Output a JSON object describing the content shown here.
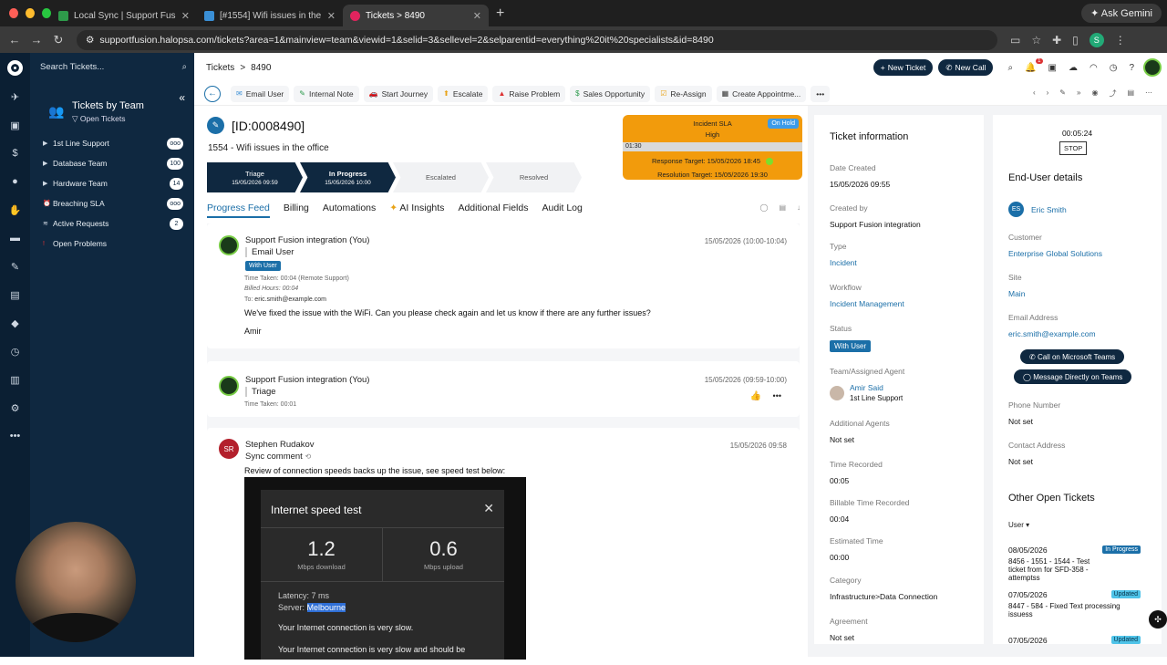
{
  "browser": {
    "tabs": [
      {
        "title": "Local Sync | Support Fusion",
        "fav": "#2e9a4a"
      },
      {
        "title": "[#1554] Wifi issues in the offi",
        "fav": "#3a8fd6"
      },
      {
        "title": "Tickets > 8490",
        "fav": "#e0245e"
      }
    ],
    "gemini": "Ask Gemini",
    "url": "supportfusion.halopsa.com/tickets?area=1&mainview=team&viewid=1&selid=3&sellevel=2&selparentid=everything%20it%20specialists&id=8490",
    "profile": "S"
  },
  "sidebar": {
    "search_placeholder": "Search Tickets...",
    "title": "Tickets by Team",
    "subtitle": "Open Tickets",
    "items": [
      {
        "label": "1st Line Support",
        "count": "ooo"
      },
      {
        "label": "Database Team",
        "count": "100"
      },
      {
        "label": "Hardware Team",
        "count": "14"
      },
      {
        "label": "Breaching SLA",
        "count": "ooo"
      },
      {
        "label": "Active Requests",
        "count": "2"
      },
      {
        "label": "Open Problems",
        "count": ""
      }
    ]
  },
  "topbar": {
    "crumb_root": "Tickets",
    "crumb_sep": ">",
    "crumb_id": "8490",
    "new_ticket": "New Ticket",
    "new_call": "New Call",
    "notif_count": "1"
  },
  "actions": [
    {
      "label": "Email User",
      "icon": "✉"
    },
    {
      "label": "Internal Note",
      "icon": "✎"
    },
    {
      "label": "Start Journey",
      "icon": "🚗"
    },
    {
      "label": "Escalate",
      "icon": "⬆"
    },
    {
      "label": "Raise Problem",
      "icon": "▲"
    },
    {
      "label": "Sales Opportunity",
      "icon": "$"
    },
    {
      "label": "Re-Assign",
      "icon": "☑"
    },
    {
      "label": "Create Appointme...",
      "icon": "▦"
    }
  ],
  "ticket": {
    "id": "[ID:0008490]",
    "summary": "1554 - Wifi issues in the office",
    "stages": [
      {
        "name": "Triage",
        "date": "15/05/2026 09:59"
      },
      {
        "name": "In Progress",
        "date": "15/05/2026 10:00"
      },
      {
        "name": "Escalated",
        "date": ""
      },
      {
        "name": "Resolved",
        "date": ""
      }
    ],
    "sla": {
      "title": "Incident SLA",
      "priority": "High",
      "status": "On Hold",
      "elapsed": "01:30",
      "response": "Response Target: 15/05/2026 18:45",
      "resolution": "Resolution Target: 15/05/2026 19:30"
    }
  },
  "tabs": [
    "Progress Feed",
    "Billing",
    "Automations",
    "AI Insights",
    "Additional Fields",
    "Audit Log"
  ],
  "feed": [
    {
      "author": "Support Fusion integration (You)",
      "action": "Email User",
      "status": "With User",
      "time_taken": "Time Taken: 00:04 (Remote Support)",
      "billed": "Billed Hours: 00:04",
      "to_label": "To:",
      "to": "eric.smith@example.com",
      "body": "We've fixed the issue with the WiFi. Can you please check again and let us know if there are any further issues?",
      "sign": "Amir",
      "time": "15/05/2026 (10:00-10:04)"
    },
    {
      "author": "Support Fusion integration (You)",
      "action": "Triage",
      "time_taken": "Time Taken: 00:01",
      "time": "15/05/2026 (09:59-10:00)"
    },
    {
      "author": "Stephen Rudakov",
      "initials": "SR",
      "action": "Sync comment",
      "body": "Review of connection speeds backs up the issue, see speed test below:",
      "time": "15/05/2026 09:58",
      "speedtest": {
        "title": "Internet speed test",
        "down": "1.2",
        "down_unit": "Mbps download",
        "up": "0.6",
        "up_unit": "Mbps upload",
        "latency": "Latency: 7 ms",
        "server_label": "Server:",
        "server": "Melbourne",
        "msg1": "Your Internet connection is very slow.",
        "msg2": "Your Internet connection is very slow and should be"
      }
    }
  ],
  "info": {
    "title": "Ticket information",
    "date_created_l": "Date Created",
    "date_created": "15/05/2026 09:55",
    "created_by_l": "Created by",
    "created_by": "Support Fusion integration",
    "type_l": "Type",
    "type": "Incident",
    "workflow_l": "Workflow",
    "workflow": "Incident Management",
    "status_l": "Status",
    "status": "With User",
    "agent_l": "Team/Assigned Agent",
    "agent": "Amir Said",
    "team": "1st Line Support",
    "add_agents_l": "Additional Agents",
    "add_agents": "Not set",
    "time_rec_l": "Time Recorded",
    "time_rec": "00:05",
    "bill_time_l": "Billable Time Recorded",
    "bill_time": "00:04",
    "est_l": "Estimated Time",
    "est": "00:00",
    "cat_l": "Category",
    "cat": "Infrastructure>Data Connection",
    "agreement_l": "Agreement",
    "agreement": "Not set"
  },
  "enduser": {
    "timer": "00:05:24",
    "stop": "STOP",
    "title": "End-User details",
    "initials": "ES",
    "name": "Eric Smith",
    "customer_l": "Customer",
    "customer": "Enterprise Global Solutions",
    "site_l": "Site",
    "site": "Main",
    "email_l": "Email Address",
    "email": "eric.smith@example.com",
    "call_btn": "Call on Microsoft Teams",
    "msg_btn": "Message Directly on Teams",
    "phone_l": "Phone Number",
    "phone": "Not set",
    "addr_l": "Contact Address",
    "addr": "Not set",
    "other_title": "Other Open Tickets",
    "filter": "User",
    "others": [
      {
        "date": "08/05/2026",
        "text": "8456 - 1551 - 1544 - Test ticket from for SFD-358 - attemptss",
        "status": "In Progress"
      },
      {
        "date": "07/05/2026",
        "text": "8447 - 584 - Fixed Text processing issuess",
        "status": "Updated"
      },
      {
        "date": "07/05/2026",
        "text": "",
        "status": "Updated"
      }
    ]
  }
}
